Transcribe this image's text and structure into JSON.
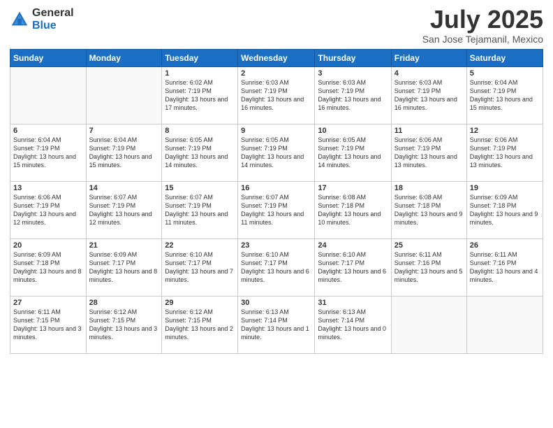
{
  "logo": {
    "general": "General",
    "blue": "Blue"
  },
  "title": "July 2025",
  "location": "San Jose Tejamanil, Mexico",
  "days_header": [
    "Sunday",
    "Monday",
    "Tuesday",
    "Wednesday",
    "Thursday",
    "Friday",
    "Saturday"
  ],
  "weeks": [
    [
      {
        "day": "",
        "info": ""
      },
      {
        "day": "",
        "info": ""
      },
      {
        "day": "1",
        "info": "Sunrise: 6:02 AM\nSunset: 7:19 PM\nDaylight: 13 hours and 17 minutes."
      },
      {
        "day": "2",
        "info": "Sunrise: 6:03 AM\nSunset: 7:19 PM\nDaylight: 13 hours and 16 minutes."
      },
      {
        "day": "3",
        "info": "Sunrise: 6:03 AM\nSunset: 7:19 PM\nDaylight: 13 hours and 16 minutes."
      },
      {
        "day": "4",
        "info": "Sunrise: 6:03 AM\nSunset: 7:19 PM\nDaylight: 13 hours and 16 minutes."
      },
      {
        "day": "5",
        "info": "Sunrise: 6:04 AM\nSunset: 7:19 PM\nDaylight: 13 hours and 15 minutes."
      }
    ],
    [
      {
        "day": "6",
        "info": "Sunrise: 6:04 AM\nSunset: 7:19 PM\nDaylight: 13 hours and 15 minutes."
      },
      {
        "day": "7",
        "info": "Sunrise: 6:04 AM\nSunset: 7:19 PM\nDaylight: 13 hours and 15 minutes."
      },
      {
        "day": "8",
        "info": "Sunrise: 6:05 AM\nSunset: 7:19 PM\nDaylight: 13 hours and 14 minutes."
      },
      {
        "day": "9",
        "info": "Sunrise: 6:05 AM\nSunset: 7:19 PM\nDaylight: 13 hours and 14 minutes."
      },
      {
        "day": "10",
        "info": "Sunrise: 6:05 AM\nSunset: 7:19 PM\nDaylight: 13 hours and 14 minutes."
      },
      {
        "day": "11",
        "info": "Sunrise: 6:06 AM\nSunset: 7:19 PM\nDaylight: 13 hours and 13 minutes."
      },
      {
        "day": "12",
        "info": "Sunrise: 6:06 AM\nSunset: 7:19 PM\nDaylight: 13 hours and 13 minutes."
      }
    ],
    [
      {
        "day": "13",
        "info": "Sunrise: 6:06 AM\nSunset: 7:19 PM\nDaylight: 13 hours and 12 minutes."
      },
      {
        "day": "14",
        "info": "Sunrise: 6:07 AM\nSunset: 7:19 PM\nDaylight: 13 hours and 12 minutes."
      },
      {
        "day": "15",
        "info": "Sunrise: 6:07 AM\nSunset: 7:19 PM\nDaylight: 13 hours and 11 minutes."
      },
      {
        "day": "16",
        "info": "Sunrise: 6:07 AM\nSunset: 7:19 PM\nDaylight: 13 hours and 11 minutes."
      },
      {
        "day": "17",
        "info": "Sunrise: 6:08 AM\nSunset: 7:18 PM\nDaylight: 13 hours and 10 minutes."
      },
      {
        "day": "18",
        "info": "Sunrise: 6:08 AM\nSunset: 7:18 PM\nDaylight: 13 hours and 9 minutes."
      },
      {
        "day": "19",
        "info": "Sunrise: 6:09 AM\nSunset: 7:18 PM\nDaylight: 13 hours and 9 minutes."
      }
    ],
    [
      {
        "day": "20",
        "info": "Sunrise: 6:09 AM\nSunset: 7:18 PM\nDaylight: 13 hours and 8 minutes."
      },
      {
        "day": "21",
        "info": "Sunrise: 6:09 AM\nSunset: 7:17 PM\nDaylight: 13 hours and 8 minutes."
      },
      {
        "day": "22",
        "info": "Sunrise: 6:10 AM\nSunset: 7:17 PM\nDaylight: 13 hours and 7 minutes."
      },
      {
        "day": "23",
        "info": "Sunrise: 6:10 AM\nSunset: 7:17 PM\nDaylight: 13 hours and 6 minutes."
      },
      {
        "day": "24",
        "info": "Sunrise: 6:10 AM\nSunset: 7:17 PM\nDaylight: 13 hours and 6 minutes."
      },
      {
        "day": "25",
        "info": "Sunrise: 6:11 AM\nSunset: 7:16 PM\nDaylight: 13 hours and 5 minutes."
      },
      {
        "day": "26",
        "info": "Sunrise: 6:11 AM\nSunset: 7:16 PM\nDaylight: 13 hours and 4 minutes."
      }
    ],
    [
      {
        "day": "27",
        "info": "Sunrise: 6:11 AM\nSunset: 7:15 PM\nDaylight: 13 hours and 3 minutes."
      },
      {
        "day": "28",
        "info": "Sunrise: 6:12 AM\nSunset: 7:15 PM\nDaylight: 13 hours and 3 minutes."
      },
      {
        "day": "29",
        "info": "Sunrise: 6:12 AM\nSunset: 7:15 PM\nDaylight: 13 hours and 2 minutes."
      },
      {
        "day": "30",
        "info": "Sunrise: 6:13 AM\nSunset: 7:14 PM\nDaylight: 13 hours and 1 minute."
      },
      {
        "day": "31",
        "info": "Sunrise: 6:13 AM\nSunset: 7:14 PM\nDaylight: 13 hours and 0 minutes."
      },
      {
        "day": "",
        "info": ""
      },
      {
        "day": "",
        "info": ""
      }
    ]
  ]
}
